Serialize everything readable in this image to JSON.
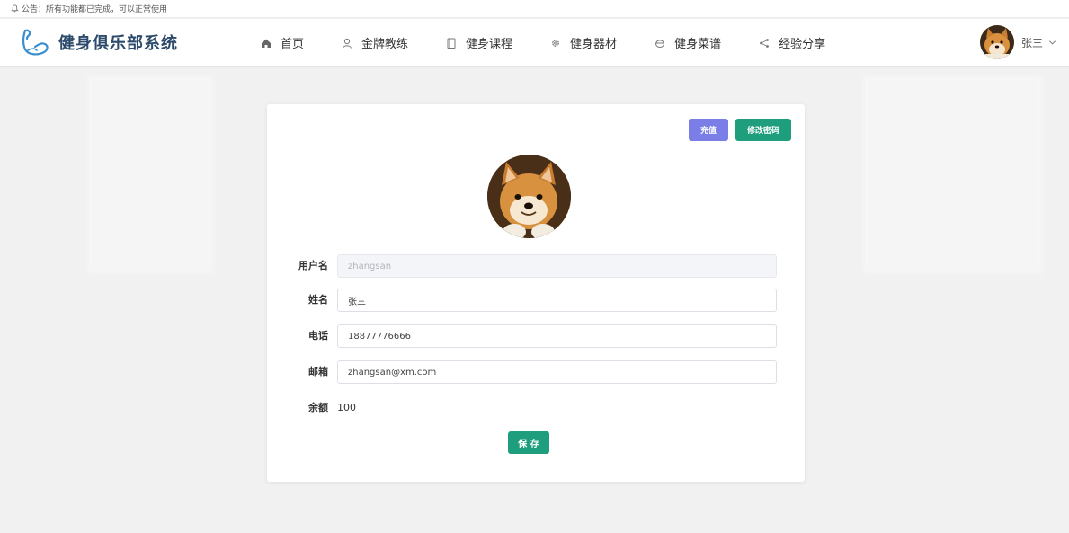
{
  "notice": {
    "text": "公告：所有功能都已完成，可以正常使用"
  },
  "brand": {
    "title": "健身俱乐部系统"
  },
  "nav": [
    {
      "label": "首页",
      "icon": "home-icon"
    },
    {
      "label": "金牌教练",
      "icon": "user-icon"
    },
    {
      "label": "健身课程",
      "icon": "book-icon"
    },
    {
      "label": "健身器材",
      "icon": "gear-icon"
    },
    {
      "label": "健身菜谱",
      "icon": "bowl-icon"
    },
    {
      "label": "经验分享",
      "icon": "share-icon"
    }
  ],
  "user": {
    "name": "张三"
  },
  "actions": {
    "recharge": "充值",
    "change_password": "修改密码"
  },
  "form": {
    "username": {
      "label": "用户名",
      "value": "zhangsan"
    },
    "name": {
      "label": "姓名",
      "value": "张三"
    },
    "phone": {
      "label": "电话",
      "value": "18877776666"
    },
    "email": {
      "label": "邮箱",
      "value": "zhangsan@xm.com"
    },
    "balance": {
      "label": "余额",
      "value": "100"
    },
    "save": "保 存"
  },
  "colors": {
    "brand": "#2c4a6b",
    "recharge": "#7b7ee6",
    "primary": "#1e9e7c"
  }
}
